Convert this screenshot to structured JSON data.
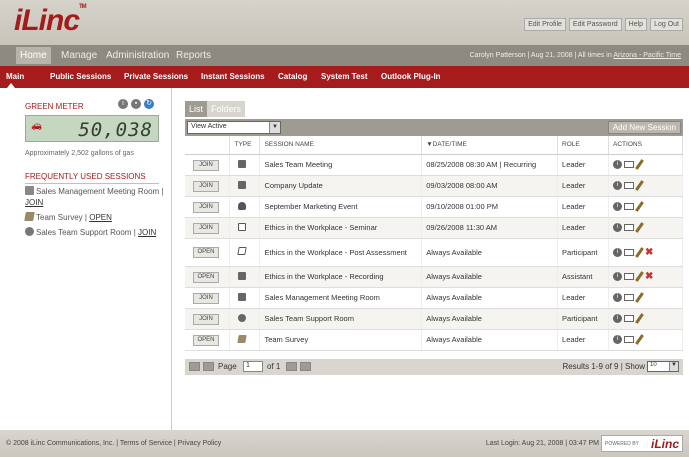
{
  "header": {
    "logo_text": "iLinc",
    "logo_tm": "TM",
    "utility_links": [
      "Edit Profile",
      "Edit Password",
      "Help",
      "Log Out"
    ]
  },
  "nav_primary": {
    "items": [
      "Home",
      "Manage",
      "Administration",
      "Reports"
    ],
    "user_info": "Carolyn Patterson | Aug 21, 2008 | All times in",
    "timezone_link": "Arizona - Pacific Time"
  },
  "nav_secondary": {
    "items": [
      "Main",
      "Public Sessions",
      "Private Sessions",
      "Instant Sessions",
      "Catalog",
      "System Test",
      "Outlook Plug-In"
    ],
    "active": "Main"
  },
  "sidebar": {
    "green_meter_title": "GREEN METER",
    "meter_value": "50,038",
    "gas_text": "Approximately 2,502 gallons of gas",
    "frequently_used_title": "FREQUENTLY USED SESSIONS",
    "frequent_sessions": [
      {
        "name": "Sales Management Meeting Room",
        "action": "JOIN",
        "icon": "meeting-icon"
      },
      {
        "name": "Team Survey",
        "action": "OPEN",
        "icon": "survey-icon"
      },
      {
        "name": "Sales Team Support Room",
        "action": "JOIN",
        "icon": "room-icon"
      }
    ]
  },
  "main": {
    "tabs": [
      "List",
      "Folders"
    ],
    "active_tab": "List",
    "view_select": "View Active",
    "add_button": "Add New Session",
    "columns": [
      "",
      "TYPE",
      "SESSION NAME",
      "▼DATE/TIME",
      "ROLE",
      "ACTIONS"
    ],
    "rows": [
      {
        "action": "JOIN",
        "type": "meeting",
        "name": "Sales Team Meeting",
        "datetime": "08/25/2008 08:30 AM | Recurring",
        "role": "Leader",
        "delete": false
      },
      {
        "action": "JOIN",
        "type": "meeting",
        "name": "Company Update",
        "datetime": "09/03/2008 08:00 AM",
        "role": "Leader",
        "delete": false
      },
      {
        "action": "JOIN",
        "type": "event",
        "name": "September Marketing Event",
        "datetime": "09/10/2008 01:00 PM",
        "role": "Leader",
        "delete": false
      },
      {
        "action": "JOIN",
        "type": "seminar",
        "name": "Ethics in the Workplace - Seminar",
        "datetime": "09/26/2008 11:30 AM",
        "role": "Leader",
        "delete": false
      },
      {
        "action": "OPEN",
        "type": "post",
        "name": "Ethics in the Workplace - Post Assessment",
        "datetime": "Always Available",
        "role": "Participant",
        "delete": true
      },
      {
        "action": "OPEN",
        "type": "meeting",
        "name": "Ethics in the Workplace - Recording",
        "datetime": "Always Available",
        "role": "Assistant",
        "delete": true
      },
      {
        "action": "JOIN",
        "type": "meeting",
        "name": "Sales Management Meeting Room",
        "datetime": "Always Available",
        "role": "Leader",
        "delete": false
      },
      {
        "action": "JOIN",
        "type": "room",
        "name": "Sales Team Support Room",
        "datetime": "Always Available",
        "role": "Participant",
        "delete": false
      },
      {
        "action": "OPEN",
        "type": "survey",
        "name": "Team Survey",
        "datetime": "Always Available",
        "role": "Leader",
        "delete": false
      }
    ],
    "pager": {
      "page_label": "Page",
      "page_value": "1",
      "of_label": "of 1",
      "results": "Results 1-9 of 9 | Show",
      "show_value": "10"
    }
  },
  "footer": {
    "copyright": "© 2008 iLinc Communications, Inc. | Terms of Service | Privacy Policy",
    "last_login": "Last Login: Aug 21, 2008 | 03:47 PM",
    "powered_by": "POWERED BY",
    "powered_logo": "iLinc"
  },
  "colors": {
    "brand_red": "#a61b1b",
    "nav_gray": "#8e8a82",
    "meter_green": "#c5d7c0"
  }
}
